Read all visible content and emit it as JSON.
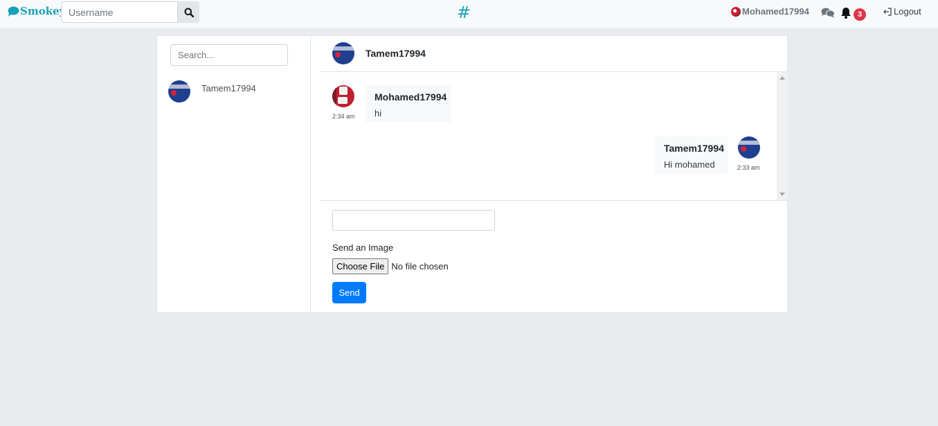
{
  "navbar": {
    "brand": "Smokey",
    "search_placeholder": "Username",
    "center_symbol": "#",
    "user_name": "Mohamed17994",
    "notification_count": "3",
    "logout_label": "Logout",
    "icons": [
      "chat-bubble-icon",
      "search-icon",
      "user-avatar-icon",
      "comments-icon",
      "bell-icon",
      "logout-icon"
    ]
  },
  "sidebar": {
    "search_placeholder": "Search...",
    "contacts": [
      {
        "name": "Tamem17994"
      }
    ]
  },
  "chat": {
    "partner_name": "Tamem17994",
    "messages": [
      {
        "sender": "Mohamed17994",
        "text": "hi",
        "time": "2:34 am",
        "side": "left"
      },
      {
        "sender": "Tamem17994",
        "text": "Hi mohamed",
        "time": "2:33 am",
        "side": "right"
      }
    ],
    "composer": {
      "message_value": "",
      "image_label": "Send an Image",
      "file_button_label": "Choose File",
      "file_status": "No file chosen",
      "send_label": "Send"
    }
  },
  "colors": {
    "brand": "#17a2b8",
    "primary": "#007bff",
    "danger": "#dc3545",
    "background": "#e9ecef"
  }
}
